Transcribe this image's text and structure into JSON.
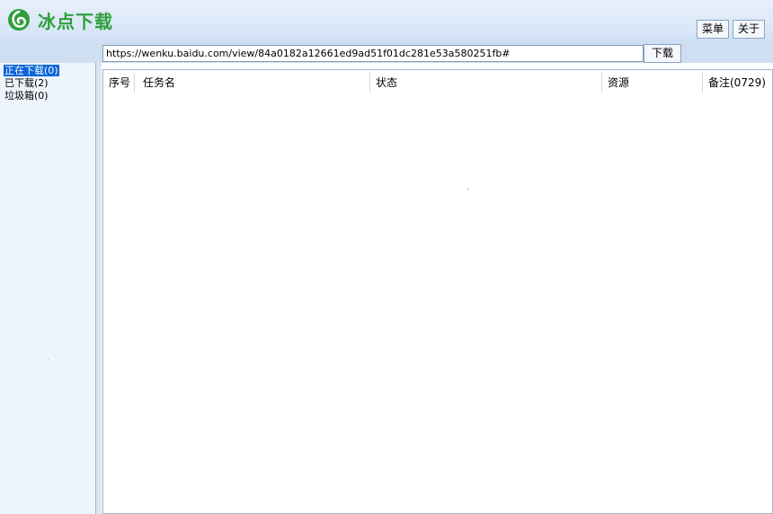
{
  "app": {
    "title": "冰点下载",
    "brand_color": "#2f9e3c"
  },
  "header": {
    "menu_label": "菜单",
    "about_label": "关于"
  },
  "toolbar": {
    "url_value": "https://wenku.baidu.com/view/84a0182a12661ed9ad51f01dc281e53a580251fb#",
    "download_label": "下载"
  },
  "sidebar": {
    "items": [
      {
        "label": "正在下载(0)",
        "active": true
      },
      {
        "label": "已下载(2)",
        "active": false
      },
      {
        "label": "垃圾箱(0)",
        "active": false
      }
    ]
  },
  "table": {
    "columns": [
      "序号",
      "任务名",
      "状态",
      "资源",
      "备注(0729)"
    ],
    "rows": []
  },
  "colors": {
    "header_bg": "#d3e3f6",
    "selected_bg": "#0a64d8"
  }
}
